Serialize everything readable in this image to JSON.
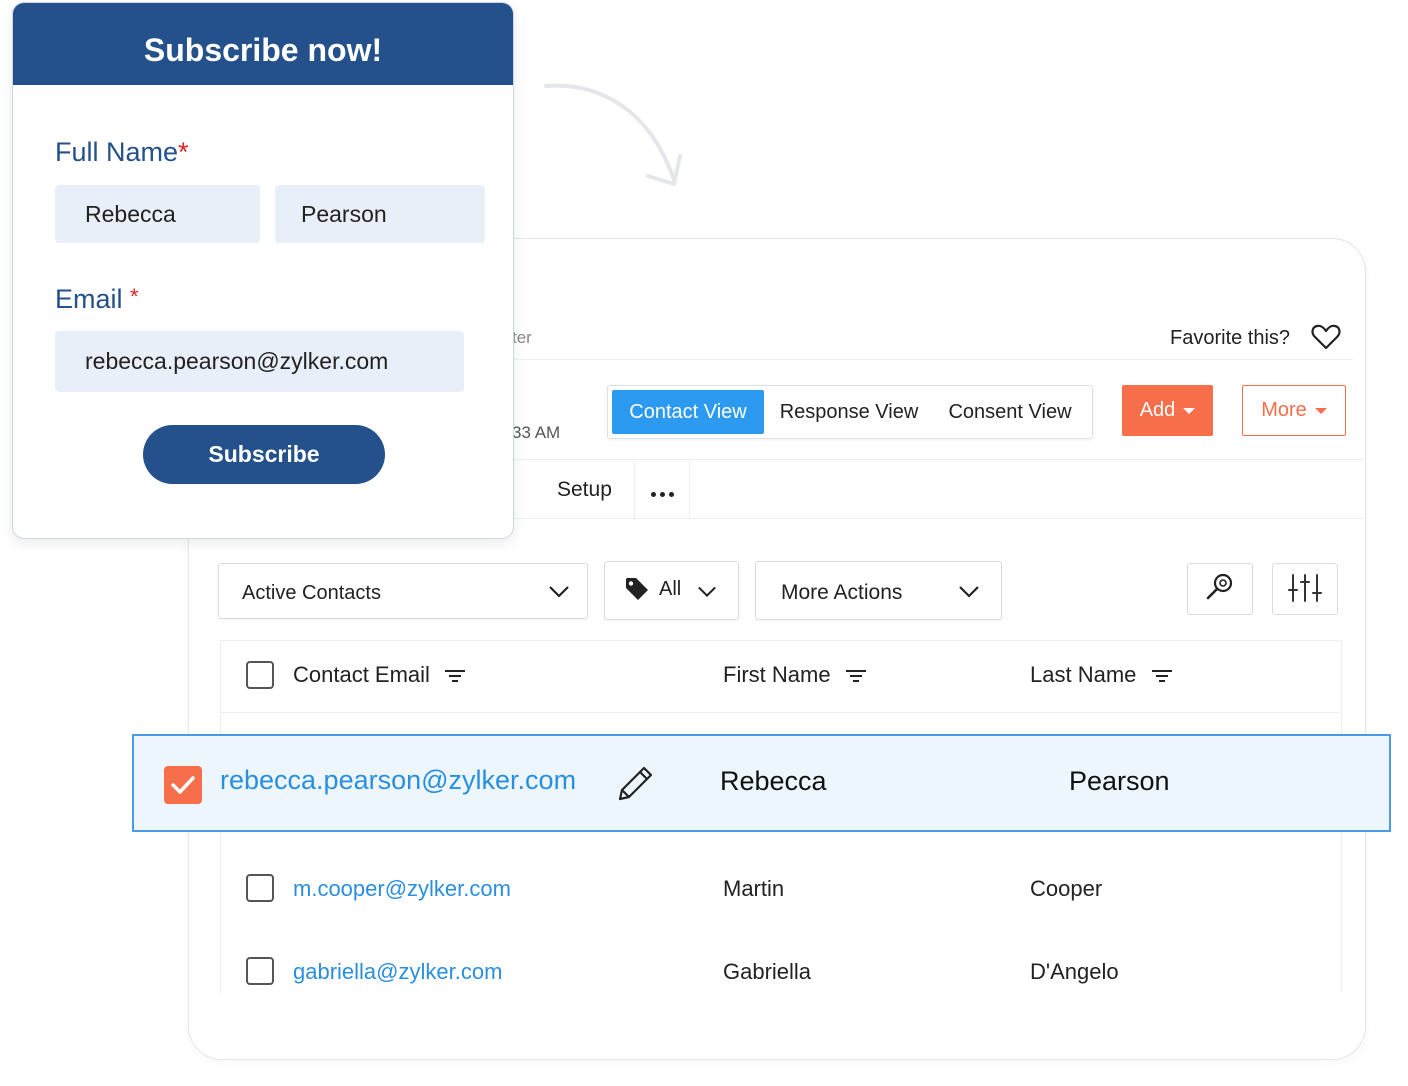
{
  "app": {
    "breadcrumb_fragment": "ter",
    "time_fragment": "33 AM",
    "favorite_label": "Favorite this?",
    "views": [
      "Contact View",
      "Response View",
      "Consent View"
    ],
    "active_view": "Contact View",
    "add_label": "Add",
    "more_label": "More",
    "tabs": {
      "setup": "Setup"
    },
    "filters": {
      "list": "Active Contacts",
      "tag": "All",
      "actions": "More Actions"
    },
    "table": {
      "columns": [
        "Contact Email",
        "First Name",
        "Last Name"
      ],
      "selected_row": {
        "email": "rebecca.pearson@zylker.com",
        "first": "Rebecca",
        "last": "Pearson",
        "checked": true
      },
      "rows": [
        {
          "email": "m.cooper@zylker.com",
          "first": "Martin",
          "last": "Cooper",
          "checked": false
        },
        {
          "email": "gabriella@zylker.com",
          "first": "Gabriella",
          "last": "D'Angelo",
          "checked": false
        }
      ]
    },
    "colors": {
      "accent_blue": "#2c9af0",
      "accent_orange": "#f76e4a",
      "brand_navy": "#24508b"
    }
  },
  "subscribe": {
    "title": "Subscribe now!",
    "full_name_label": "Full Name",
    "email_label": "Email",
    "required_mark": "*",
    "first_name_value": "Rebecca",
    "last_name_value": "Pearson",
    "email_value": "rebecca.pearson@zylker.com",
    "button": "Subscribe"
  }
}
